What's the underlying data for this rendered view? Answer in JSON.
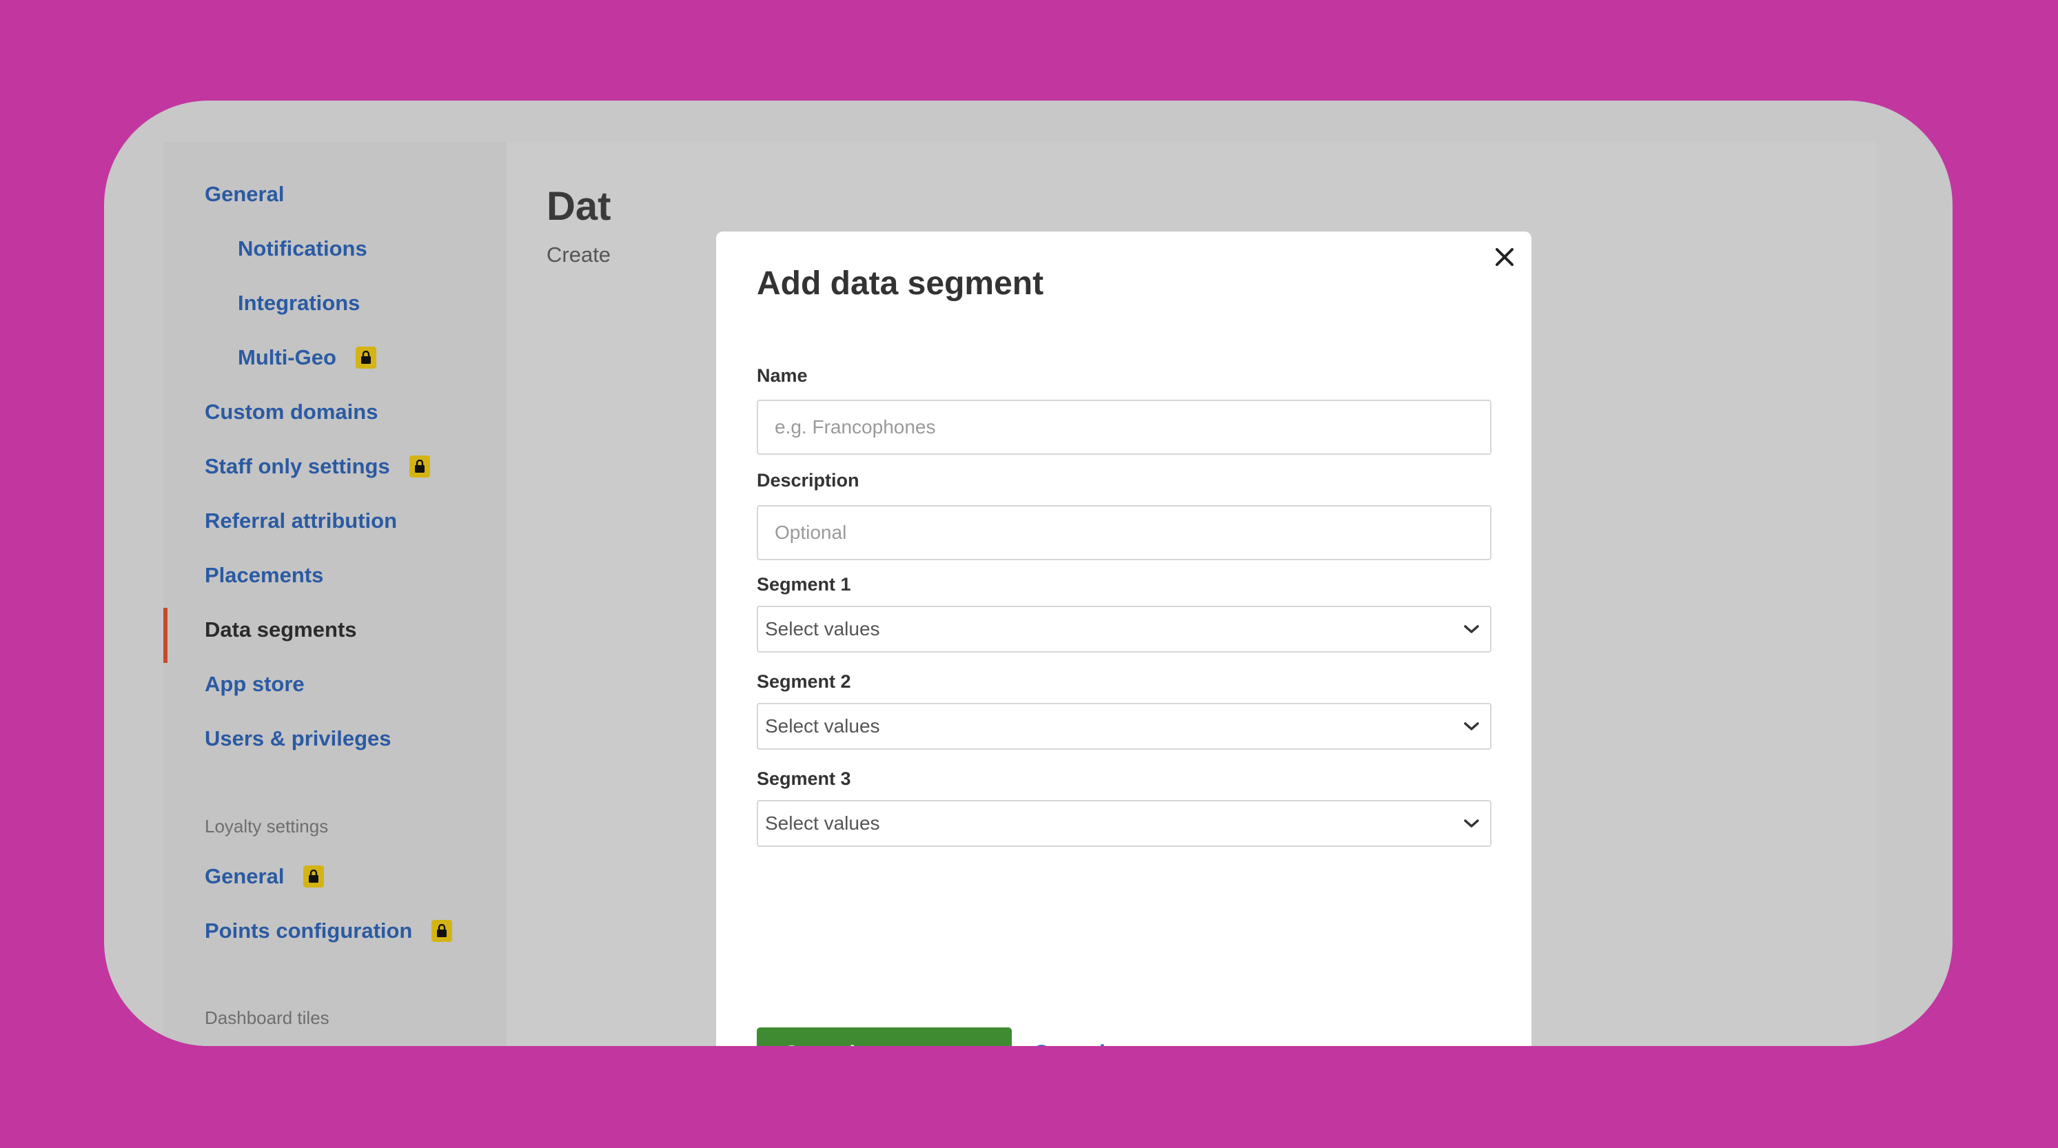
{
  "sidebar": {
    "items": [
      {
        "label": "General"
      },
      {
        "label": "Notifications"
      },
      {
        "label": "Integrations"
      },
      {
        "label": "Multi-Geo"
      },
      {
        "label": "Custom domains"
      },
      {
        "label": "Staff only settings"
      },
      {
        "label": "Referral attribution"
      },
      {
        "label": "Placements"
      },
      {
        "label": "Data segments",
        "active": true
      },
      {
        "label": "App store"
      },
      {
        "label": "Users & privileges"
      }
    ],
    "loyalty_section": "Loyalty settings",
    "loyalty_items": [
      {
        "label": "General"
      },
      {
        "label": "Points configuration"
      }
    ],
    "dashboard_section": "Dashboard tiles",
    "lock_icon": "lock-icon"
  },
  "main": {
    "title": "Dat",
    "subtitle": "Create"
  },
  "modal": {
    "title": "Add data segment",
    "name_label": "Name",
    "name_placeholder": "e.g. Francophones",
    "description_label": "Description",
    "description_placeholder": "Optional",
    "segments": [
      {
        "label": "Segment 1",
        "value": "Select values"
      },
      {
        "label": "Segment 2",
        "value": "Select values"
      },
      {
        "label": "Segment 3",
        "value": "Select values"
      }
    ],
    "save_label": "Save data segment",
    "cancel_label": "Cancel"
  },
  "colors": {
    "background": "#c236a0",
    "link": "#2a5aa3",
    "primary_button": "#3f8b32",
    "active_indicator": "#c64a2e",
    "lock_badge": "#d4b415"
  }
}
